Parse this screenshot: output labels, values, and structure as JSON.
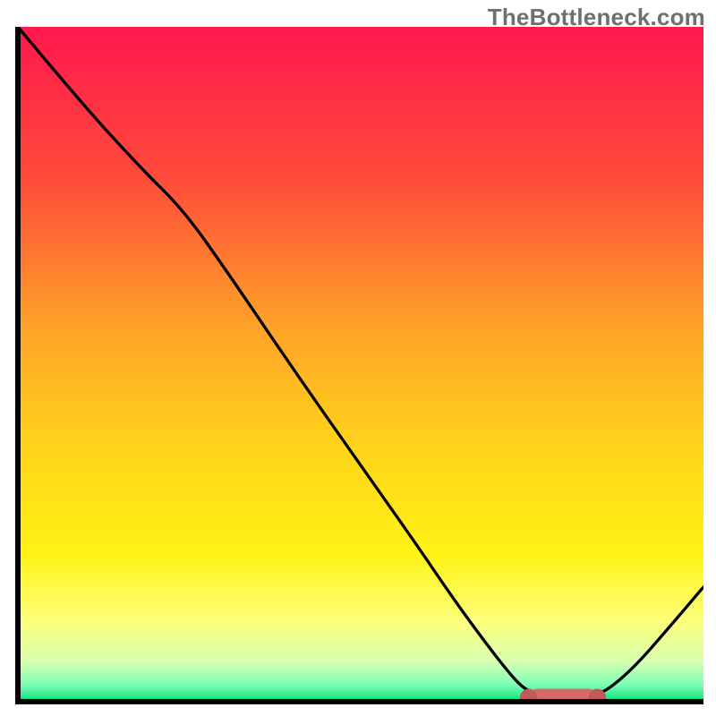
{
  "watermark": "TheBottleneck.com",
  "chart_data": {
    "type": "line",
    "title": "",
    "xlabel": "",
    "ylabel": "",
    "xlim": [
      0,
      100
    ],
    "ylim": [
      0,
      100
    ],
    "background": {
      "stops": [
        {
          "offset": 0.0,
          "color": "#ff184c"
        },
        {
          "offset": 0.22,
          "color": "#ff4a3a"
        },
        {
          "offset": 0.45,
          "color": "#ffa428"
        },
        {
          "offset": 0.62,
          "color": "#ffd31a"
        },
        {
          "offset": 0.78,
          "color": "#fff314"
        },
        {
          "offset": 0.88,
          "color": "#fdff7a"
        },
        {
          "offset": 0.94,
          "color": "#d9ffb0"
        },
        {
          "offset": 0.975,
          "color": "#7cffb5"
        },
        {
          "offset": 1.0,
          "color": "#04e07c"
        }
      ]
    },
    "axis": {
      "stroke": "#000000",
      "width": 6
    },
    "curve": {
      "stroke": "#000000",
      "width": 3.3,
      "points": [
        {
          "x": 0,
          "y": 100
        },
        {
          "x": 9,
          "y": 89
        },
        {
          "x": 18,
          "y": 79
        },
        {
          "x": 24,
          "y": 73
        },
        {
          "x": 30,
          "y": 64.5
        },
        {
          "x": 40,
          "y": 49.5
        },
        {
          "x": 50,
          "y": 35
        },
        {
          "x": 58,
          "y": 23.5
        },
        {
          "x": 63,
          "y": 16
        },
        {
          "x": 68,
          "y": 9
        },
        {
          "x": 72,
          "y": 3.8
        },
        {
          "x": 74,
          "y": 1.8
        },
        {
          "x": 76,
          "y": 1.0
        },
        {
          "x": 80,
          "y": 0.9
        },
        {
          "x": 84,
          "y": 1.0
        },
        {
          "x": 86,
          "y": 1.7
        },
        {
          "x": 90,
          "y": 5.2
        },
        {
          "x": 95,
          "y": 11
        },
        {
          "x": 100,
          "y": 17
        }
      ]
    },
    "optimal_bar": {
      "x0": 74.5,
      "x1": 84.5,
      "y": 0.6,
      "thickness": 2.6,
      "color": "#d46a6a",
      "cap_color": "#c25858"
    }
  }
}
